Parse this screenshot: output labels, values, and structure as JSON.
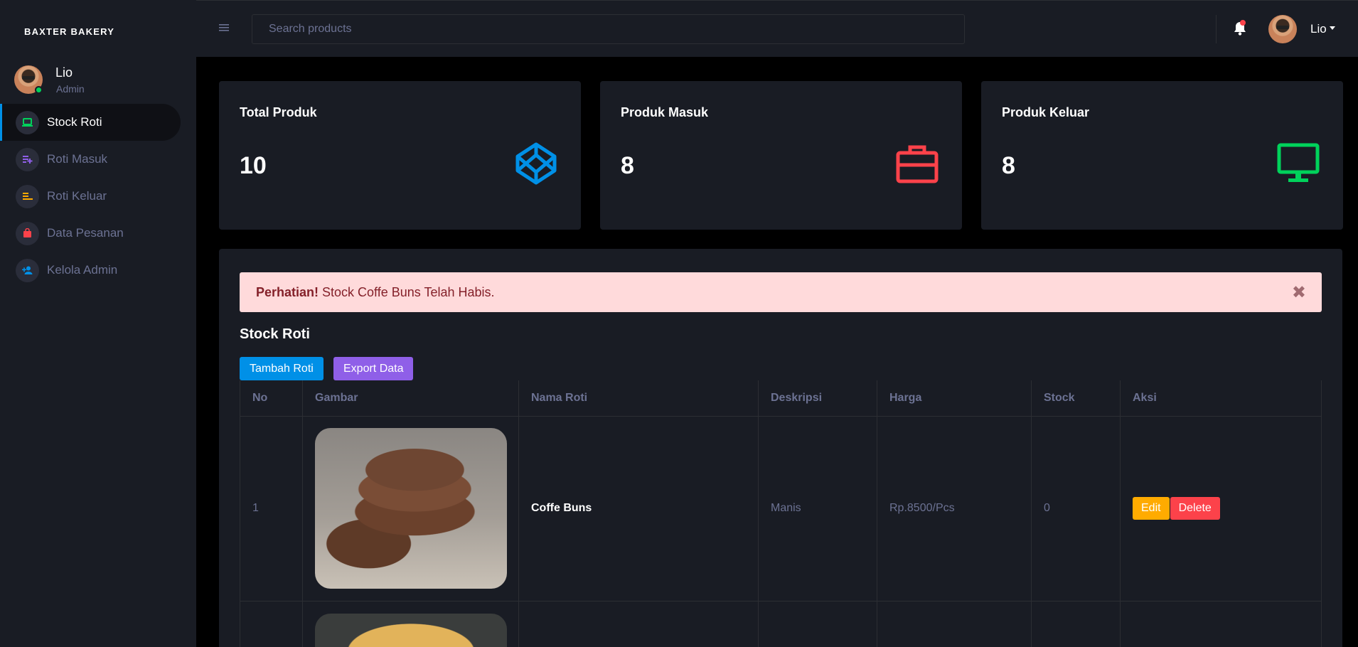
{
  "brand": "BAXTER BAKERY",
  "profile": {
    "name": "Lio",
    "role": "Admin"
  },
  "nav": [
    {
      "label": "Stock Roti",
      "icon": "laptop-icon",
      "color": "#00d25b",
      "active": true
    },
    {
      "label": "Roti Masuk",
      "icon": "playlist-add-icon",
      "color": "#8f5fe8",
      "active": false
    },
    {
      "label": "Roti Keluar",
      "icon": "list-icon",
      "color": "#ffab00",
      "active": false
    },
    {
      "label": "Data Pesanan",
      "icon": "shopping-bag-icon",
      "color": "#fc424a",
      "active": false
    },
    {
      "label": "Kelola Admin",
      "icon": "account-plus-icon",
      "color": "#0090e7",
      "active": false
    }
  ],
  "topbar": {
    "search_placeholder": "Search products",
    "user": "Lio"
  },
  "cards": [
    {
      "title": "Total Produk",
      "value": "10",
      "icon": "codepen-icon",
      "color": "#0090e7"
    },
    {
      "title": "Produk Masuk",
      "value": "8",
      "icon": "briefcase-icon",
      "color": "#fc424a"
    },
    {
      "title": "Produk Keluar",
      "value": "8",
      "icon": "monitor-icon",
      "color": "#00d25b"
    }
  ],
  "alert": {
    "strong": "Perhatian!",
    "text": " Stock Coffe Buns Telah Habis.",
    "close": "✖"
  },
  "section_title": "Stock Roti",
  "buttons": {
    "add": "Tambah Roti",
    "export": "Export Data"
  },
  "table": {
    "headers": [
      "No",
      "Gambar",
      "Nama Roti",
      "Deskripsi",
      "Harga",
      "Stock",
      "Aksi"
    ],
    "rows": [
      {
        "no": "1",
        "nama": "Coffe Buns",
        "deskripsi": "Manis",
        "harga": "Rp.8500/Pcs",
        "stock": "0",
        "edit": "Edit",
        "delete": "Delete"
      }
    ]
  }
}
